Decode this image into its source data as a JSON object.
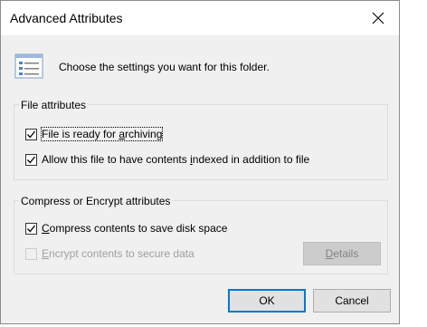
{
  "window": {
    "title": "Advanced Attributes"
  },
  "header": {
    "intro_text": "Choose the settings you want for this folder."
  },
  "file_attributes": {
    "legend": "File attributes",
    "archive": {
      "label_pre": "File is ready for ",
      "label_key": "a",
      "label_post": "rchiving",
      "checked": true
    },
    "indexed": {
      "label_pre": "Allow this file to have contents ",
      "label_key": "i",
      "label_post": "ndexed in addition to file",
      "checked": true
    }
  },
  "compress_encrypt": {
    "legend": "Compress or Encrypt attributes",
    "compress": {
      "label_key": "C",
      "label_post": "ompress contents to save disk space",
      "checked": true
    },
    "encrypt": {
      "label_key": "E",
      "label_post": "ncrypt contents to secure data",
      "checked": false,
      "disabled": true
    },
    "details_button": {
      "label_key": "D",
      "label_post": "etails",
      "disabled": true
    }
  },
  "footer": {
    "ok_label": "OK",
    "cancel_label": "Cancel"
  },
  "colors": {
    "dialog_bg": "#f0f0f0",
    "accent": "#0078d7",
    "disabled_text": "#a0a0a0"
  },
  "icons": {
    "close": "close-icon",
    "settings": "attributes-list-icon",
    "check": "checkmark-icon"
  }
}
